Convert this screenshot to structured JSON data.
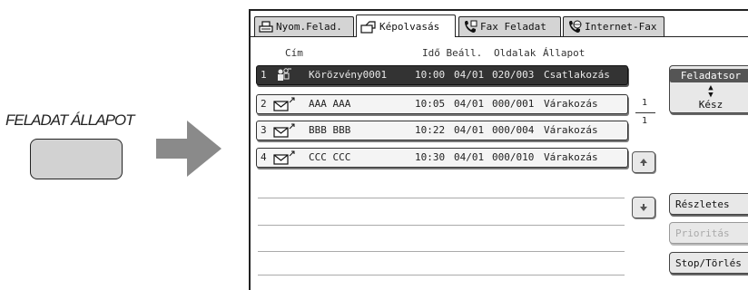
{
  "illustration": {
    "caption": "FELADAT ÁLLAPOT"
  },
  "tabs": [
    {
      "label": "Nyom.Felad.",
      "icon": "printer-icon",
      "active": false
    },
    {
      "label": "Képolvasás",
      "icon": "scanner-icon",
      "active": true
    },
    {
      "label": "Fax Feladat",
      "icon": "fax-icon",
      "active": false
    },
    {
      "label": "Internet-Fax",
      "icon": "internet-fax-icon",
      "active": false
    }
  ],
  "columns": {
    "address": "Cím",
    "time": "Idő Beáll.",
    "pages": "Oldalak",
    "status": "Állapot"
  },
  "jobs": [
    {
      "num": "1",
      "icon": "group-broadcast-icon",
      "address": "Körözvény0001",
      "time": "10:00",
      "date": "04/01",
      "pages": "020/003",
      "status": "Csatlakozás",
      "selected": true
    },
    {
      "num": "2",
      "icon": "email-icon",
      "address": "AAA AAA",
      "time": "10:05",
      "date": "04/01",
      "pages": "000/001",
      "status": "Várakozás",
      "selected": false
    },
    {
      "num": "3",
      "icon": "email-icon",
      "address": "BBB BBB",
      "time": "10:22",
      "date": "04/01",
      "pages": "000/004",
      "status": "Várakozás",
      "selected": false
    },
    {
      "num": "4",
      "icon": "email-icon",
      "address": "CCC CCC",
      "time": "10:30",
      "date": "04/01",
      "pages": "000/010",
      "status": "Várakozás",
      "selected": false
    }
  ],
  "pager": {
    "current": "1",
    "total": "1"
  },
  "buttons": {
    "queue_label": "Feladatsor",
    "done_label": "Kész",
    "details": "Részletes",
    "priority": "Prioritás",
    "stop_delete": "Stop/Törlés"
  },
  "colors": {
    "selected_row": "#333333",
    "tab_inactive": "#d4d4d4",
    "button_face": "#e8e8e8"
  }
}
